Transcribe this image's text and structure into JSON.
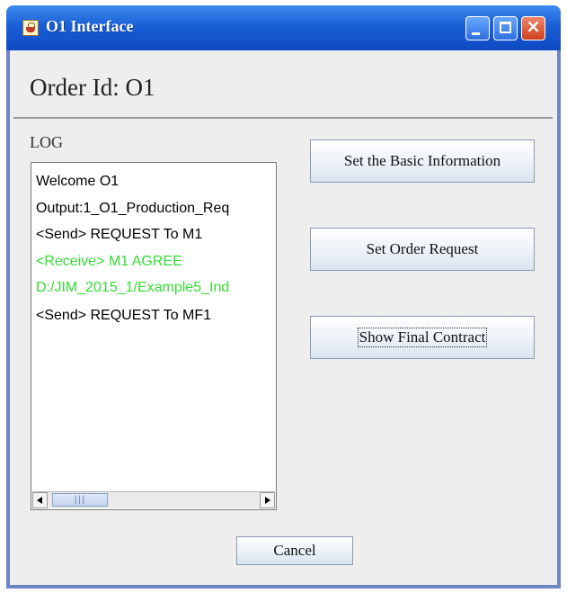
{
  "window": {
    "title": "O1 Interface",
    "close_glyph": "×",
    "icons": [
      "java-cup-icon",
      "minimize-icon",
      "maximize-icon",
      "close-icon"
    ]
  },
  "header": {
    "order_id": "Order Id: O1"
  },
  "log": {
    "label": "LOG",
    "lines": [
      {
        "text": "Welcome O1",
        "color": "#000000"
      },
      {
        "text": "Output:1_O1_Production_Req",
        "color": "#000000"
      },
      {
        "text": "<Send> REQUEST To M1",
        "color": "#000000"
      },
      {
        "text": "<Receive> M1 AGREE",
        "color": "#33dd33"
      },
      {
        "text": "D:/JIM_2015_1/Example5_Ind",
        "color": "#33dd33"
      },
      {
        "text": "<Send> REQUEST To MF1",
        "color": "#000000"
      }
    ],
    "scroll_grip": "|||"
  },
  "buttons": {
    "basic_info": "Set the Basic Information",
    "order_request": "Set Order Request",
    "final_contract": "Show Final Contract",
    "cancel": "Cancel"
  },
  "colors": {
    "titlebar": "#1a5fd6",
    "close_button": "#d0401c",
    "log_received": "#33dd33",
    "panel_background": "#eeeeee"
  }
}
